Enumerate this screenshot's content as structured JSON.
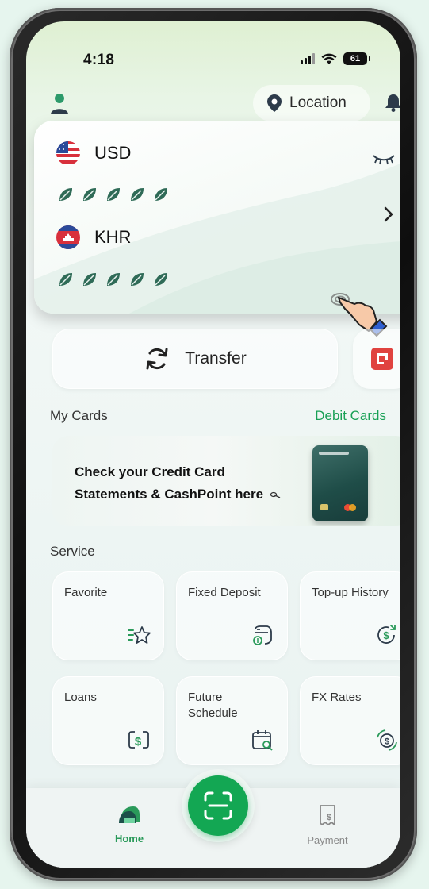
{
  "status_bar": {
    "time": "4:18",
    "battery": "61"
  },
  "header": {
    "location_label": "Location"
  },
  "balances": {
    "usd": {
      "code": "USD"
    },
    "khr": {
      "code": "KHR"
    }
  },
  "actions": {
    "transfer_label": "Transfer"
  },
  "cards_section": {
    "title": "My Cards",
    "link": "Debit Cards"
  },
  "promo": {
    "line1": "Check your Credit Card",
    "line2": "Statements & CashPoint here"
  },
  "service": {
    "title": "Service",
    "tiles": [
      {
        "label": "Favorite",
        "icon": "star-list-icon"
      },
      {
        "label": "Fixed Deposit",
        "icon": "piggy-bank-icon"
      },
      {
        "label": "Top-up History",
        "icon": "dollar-refresh-icon"
      },
      {
        "label": "Loans",
        "icon": "dollar-bracket-icon"
      },
      {
        "label": "Future Schedule",
        "icon": "calendar-search-icon"
      },
      {
        "label": "FX Rates",
        "icon": "currency-exchange-icon"
      }
    ]
  },
  "bottom_nav": {
    "home": "Home",
    "payment": "Payment"
  },
  "colors": {
    "brand_green": "#13a753",
    "link_green": "#18a055",
    "scan_red": "#e0433f"
  }
}
